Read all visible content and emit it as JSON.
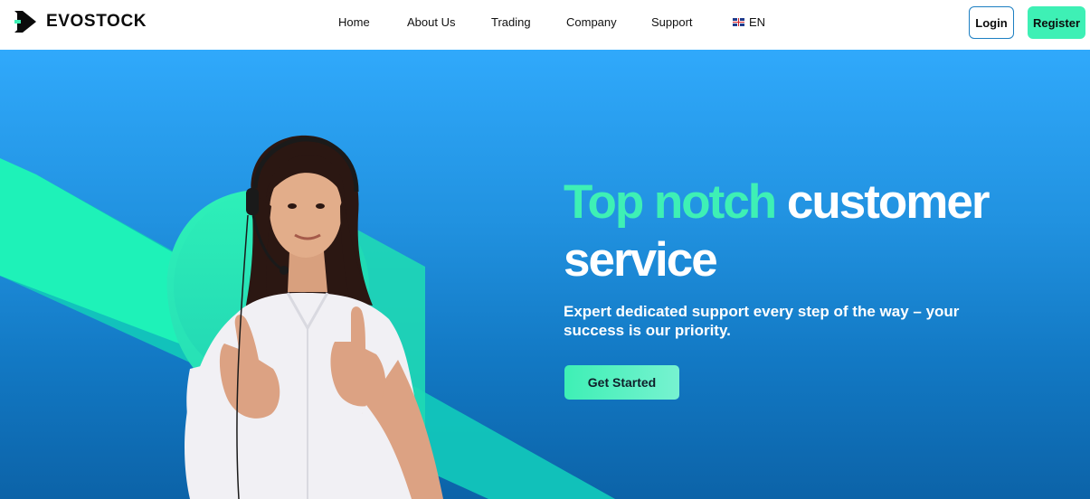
{
  "brand": {
    "name": "EVOSTOCK",
    "logo_icon": "evostock-logo-icon"
  },
  "nav": {
    "items": [
      "Home",
      "About Us",
      "Trading",
      "Company",
      "Support"
    ],
    "language": {
      "code": "EN",
      "flag_icon": "uk-flag-icon"
    }
  },
  "auth": {
    "login_label": "Login",
    "register_label": "Register"
  },
  "hero": {
    "headline_accent": "Top notch",
    "headline_rest": "customer service",
    "subtext": "Expert dedicated support every step of the way – your success is our priority.",
    "cta_label": "Get Started",
    "image": "customer-support-agent-thumbs-up"
  },
  "colors": {
    "accent": "#3ef0b5",
    "hero_gradient_top": "#30a9fb",
    "hero_gradient_bottom": "#0c63a8",
    "login_border": "#1d7fc2"
  }
}
